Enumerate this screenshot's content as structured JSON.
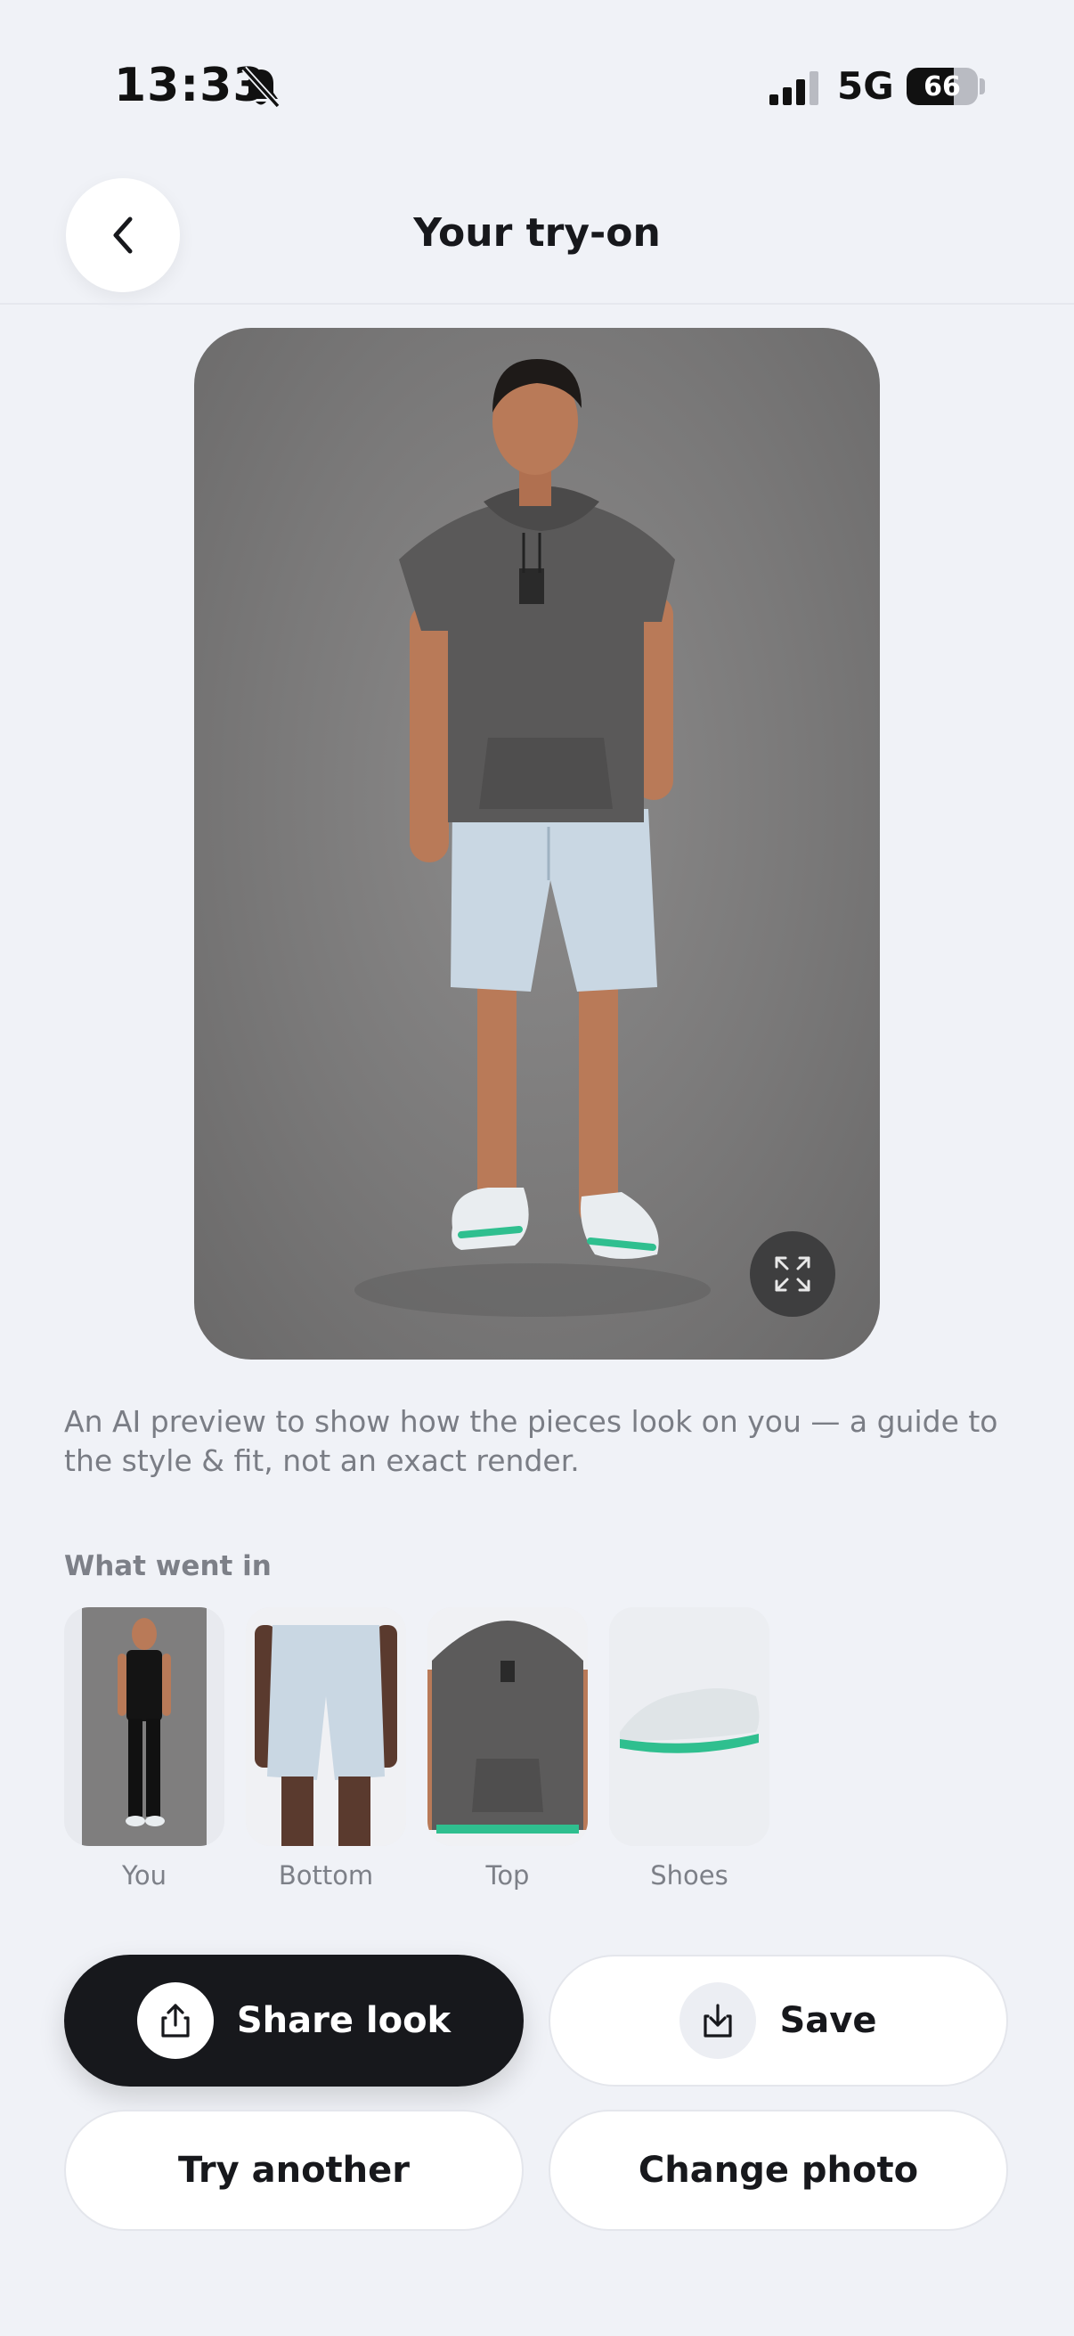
{
  "status_bar": {
    "time": "13:33",
    "network": "5G",
    "battery_level": "66",
    "battery_fraction": 0.66,
    "icons": [
      "bell-off-icon",
      "signal-icon",
      "battery-icon"
    ]
  },
  "header": {
    "title": "Your try-on",
    "back_icon": "chevron-left-icon"
  },
  "preview": {
    "expand_icon": "expand-arrows-icon",
    "disclaimer": "An AI preview to show how the pieces look on you — a guide to the style & fit, not an exact render."
  },
  "inputs": {
    "section_label": "What went in",
    "items": [
      {
        "label": "You"
      },
      {
        "label": "Bottom"
      },
      {
        "label": "Top"
      },
      {
        "label": "Shoes"
      }
    ]
  },
  "actions": {
    "share_label": "Share look",
    "share_icon": "share-icon",
    "save_label": "Save",
    "save_icon": "download-icon",
    "try_another_label": "Try another",
    "change_photo_label": "Change photo"
  },
  "colors": {
    "background": "#f0f2f7",
    "primary_button": "#17181c",
    "accent_green": "#2fbf8f"
  }
}
